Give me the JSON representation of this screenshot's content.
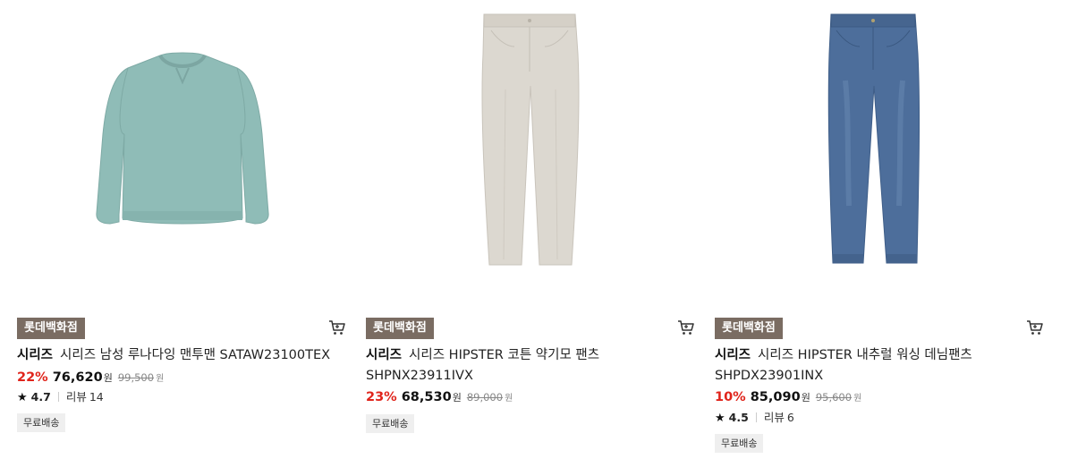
{
  "products": [
    {
      "brand_badge": "롯데백화점",
      "series": "시리즈",
      "name": "시리즈 남성 루나다잉 맨투맨 SATAW23100TEX",
      "discount": "22%",
      "price": "76,620",
      "price_unit": "원",
      "original_price": "99,500",
      "original_unit": "원",
      "rating": "4.7",
      "review_label": "리뷰",
      "review_count": "14",
      "shipping": "무료배송",
      "image": "mint-sweatshirt"
    },
    {
      "brand_badge": "롯데백화점",
      "series": "시리즈",
      "name": "시리즈 HIPSTER 코튼 약기모 팬츠 SHPNX23911IVX",
      "discount": "23%",
      "price": "68,530",
      "price_unit": "원",
      "original_price": "89,000",
      "original_unit": "원",
      "shipping": "무료배송",
      "image": "ivory-chino-pants"
    },
    {
      "brand_badge": "롯데백화점",
      "series": "시리즈",
      "name": "시리즈 HIPSTER 내추럴 워싱 데님팬츠 SHPDX23901INX",
      "discount": "10%",
      "price": "85,090",
      "price_unit": "원",
      "original_price": "95,600",
      "original_unit": "원",
      "rating": "4.5",
      "review_label": "리뷰",
      "review_count": "6",
      "shipping": "무료배송",
      "image": "blue-denim-jeans"
    }
  ],
  "colors": {
    "badge_bg": "#7a6c62",
    "discount": "#e0241b",
    "ship_tag_bg": "#efefef"
  }
}
